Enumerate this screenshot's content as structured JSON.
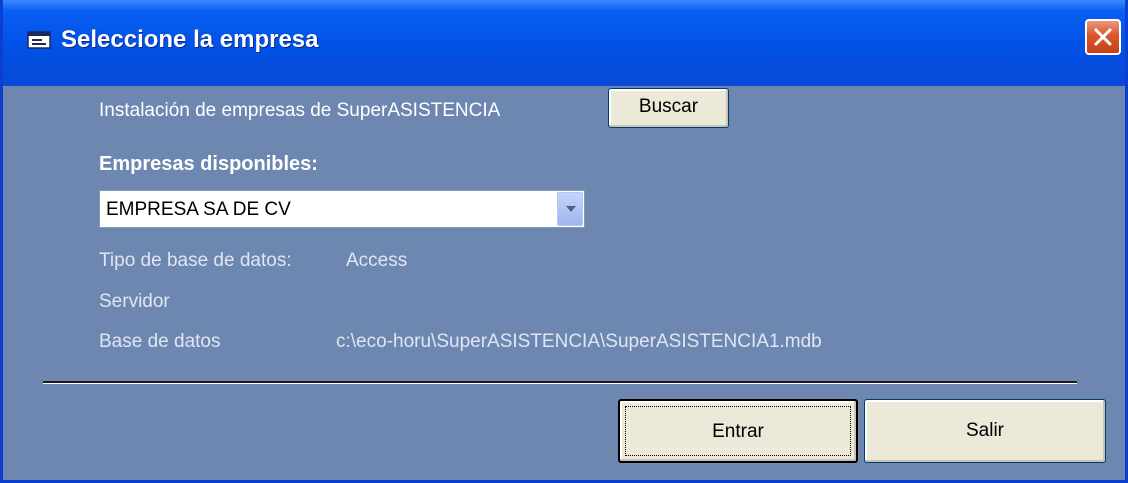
{
  "window": {
    "title": "Seleccione la empresa"
  },
  "install": {
    "label": "Instalación de empresas de SuperASISTENCIA",
    "search_button": "Buscar"
  },
  "companies": {
    "label": "Empresas disponibles:",
    "selected": "EMPRESA SA  DE CV"
  },
  "info": {
    "db_type_label": "Tipo de base de datos:",
    "db_type_value": "Access",
    "server_label": "Servidor",
    "database_label": "Base de datos",
    "database_value": "c:\\eco-horu\\SuperASISTENCIA\\SuperASISTENCIA1.mdb"
  },
  "actions": {
    "enter_button": "Entrar",
    "exit_button": "Salir"
  },
  "colors": {
    "titlebar": "#0052e6",
    "body": "#6d87b1",
    "button_face": "#ece9d8",
    "close_button": "#d9572a"
  },
  "icons": {
    "title": "window-icon",
    "close": "close-icon",
    "dropdown": "chevron-down-icon"
  }
}
